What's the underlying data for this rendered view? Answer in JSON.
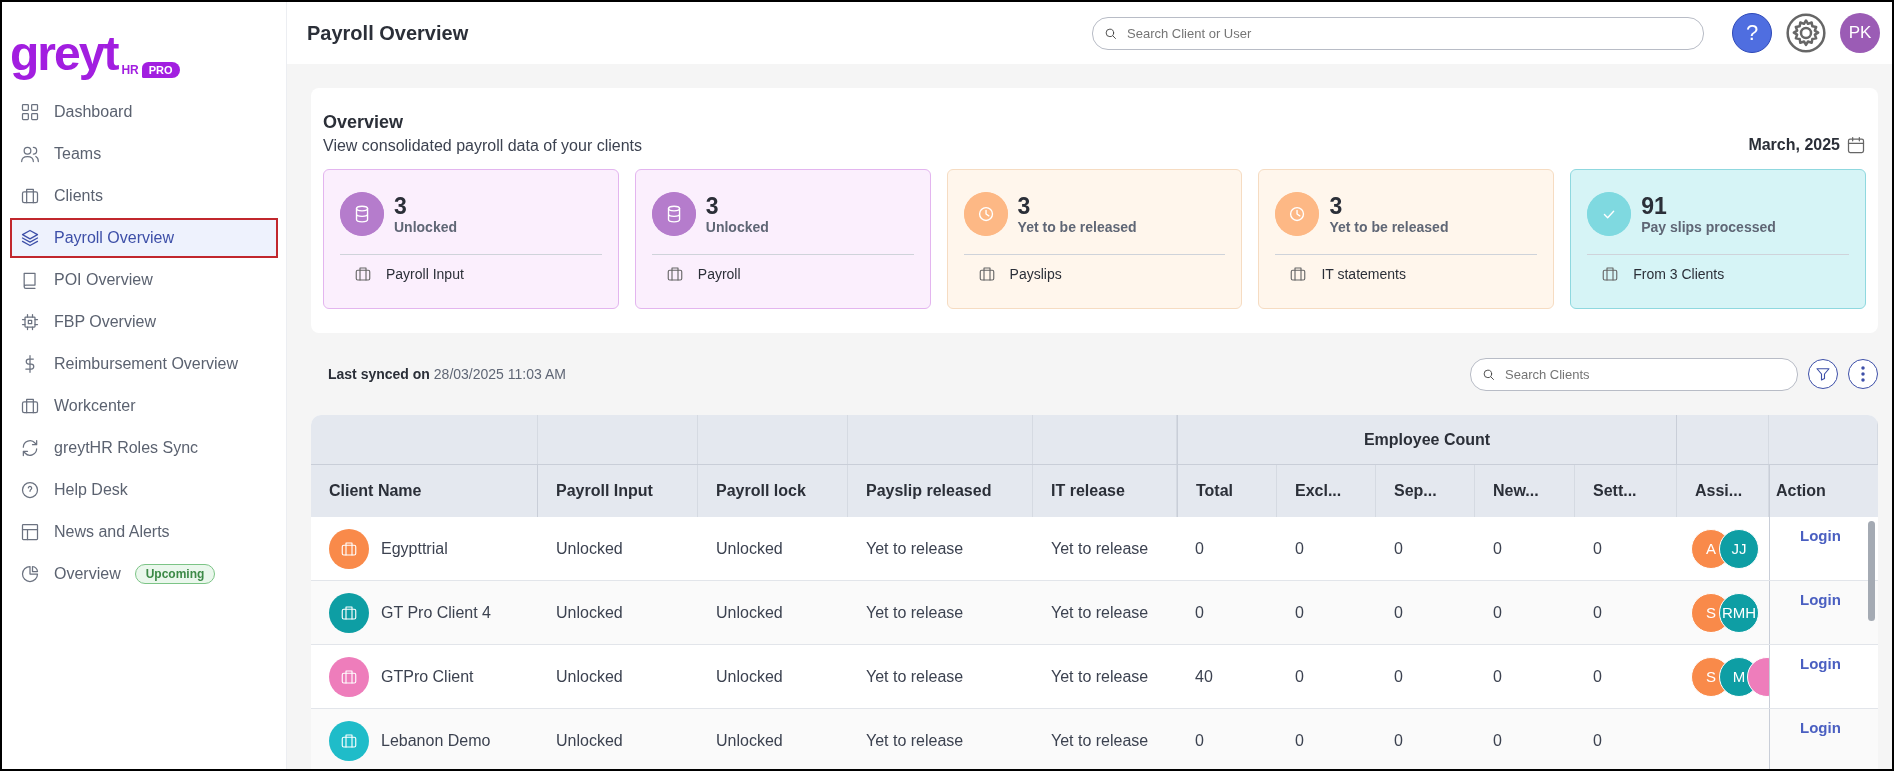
{
  "logo": {
    "wordmark": "greyt",
    "sub": "HR",
    "badge": "PRO"
  },
  "sidebar": {
    "items": [
      {
        "label": "Dashboard",
        "selected": false
      },
      {
        "label": "Teams",
        "selected": false
      },
      {
        "label": "Clients",
        "selected": false
      },
      {
        "label": "Payroll Overview",
        "selected": true
      },
      {
        "label": "POI Overview",
        "selected": false
      },
      {
        "label": "FBP Overview",
        "selected": false
      },
      {
        "label": "Reimbursement Overview",
        "selected": false
      },
      {
        "label": "Workcenter",
        "selected": false
      },
      {
        "label": "greytHR Roles Sync",
        "selected": false
      },
      {
        "label": "Help Desk",
        "selected": false
      },
      {
        "label": "News and Alerts",
        "selected": false
      },
      {
        "label": "Overview",
        "selected": false,
        "badge": "Upcoming"
      }
    ]
  },
  "header": {
    "title": "Payroll Overview",
    "search": {
      "placeholder": "Search Client or User"
    },
    "help": "?",
    "avatar": "PK"
  },
  "overview": {
    "title": "Overview",
    "subtitle": "View consolidated payroll data of your clients",
    "date": "March, 2025",
    "cards": [
      {
        "kind": "unlocked",
        "value": "3",
        "status": "Unlocked",
        "label": "Payroll Input"
      },
      {
        "kind": "unlocked",
        "value": "3",
        "status": "Unlocked",
        "label": "Payroll"
      },
      {
        "kind": "pending",
        "value": "3",
        "status": "Yet to be released",
        "label": "Payslips"
      },
      {
        "kind": "pending",
        "value": "3",
        "status": "Yet to be released",
        "label": "IT statements"
      },
      {
        "kind": "processed",
        "value": "91",
        "status": "Pay slips processed",
        "label": "From 3 Clients"
      }
    ]
  },
  "sync": {
    "label": "Last synced on",
    "time": "28/03/2025 11:03 AM"
  },
  "client_search": {
    "placeholder": "Search Clients"
  },
  "table": {
    "group_header": "Employee Count",
    "columns": [
      "Client Name",
      "Payroll Input",
      "Payroll lock",
      "Payslip released",
      "IT release",
      "Total",
      "Excl...",
      "Sep...",
      "New...",
      "Sett...",
      "Assi...",
      "Action"
    ],
    "rows": [
      {
        "color": "#f98a4a",
        "cells": [
          "Egypttrial",
          "Unlocked",
          "Unlocked",
          "Yet to release",
          "Yet to release",
          "0",
          "0",
          "0",
          "0",
          "0"
        ],
        "assignees": [
          {
            "initials": "A",
            "color": "#f98a4a"
          },
          {
            "initials": "JJ",
            "color": "#0e9ea4"
          }
        ],
        "action": "Login"
      },
      {
        "color": "#0e9ea4",
        "cells": [
          "GT Pro Client 4",
          "Unlocked",
          "Unlocked",
          "Yet to release",
          "Yet to release",
          "0",
          "0",
          "0",
          "0",
          "0"
        ],
        "assignees": [
          {
            "initials": "S",
            "color": "#f98a4a"
          },
          {
            "initials": "RMH",
            "color": "#0e9ea4"
          }
        ],
        "action": "Login"
      },
      {
        "color": "#ee7dbb",
        "cells": [
          "GTPro Client",
          "Unlocked",
          "Unlocked",
          "Yet to release",
          "Yet to release",
          "40",
          "0",
          "0",
          "0",
          "0"
        ],
        "assignees": [
          {
            "initials": "S",
            "color": "#f98a4a"
          },
          {
            "initials": "M",
            "color": "#0e9ea4"
          },
          {
            "color": "#ee7dbb"
          }
        ],
        "action": "Login"
      },
      {
        "color": "#1fbcc9",
        "cells": [
          "Lebanon Demo",
          "Unlocked",
          "Unlocked",
          "Yet to release",
          "Yet to release",
          "0",
          "0",
          "0",
          "0",
          "0"
        ],
        "action": "Login"
      }
    ]
  }
}
